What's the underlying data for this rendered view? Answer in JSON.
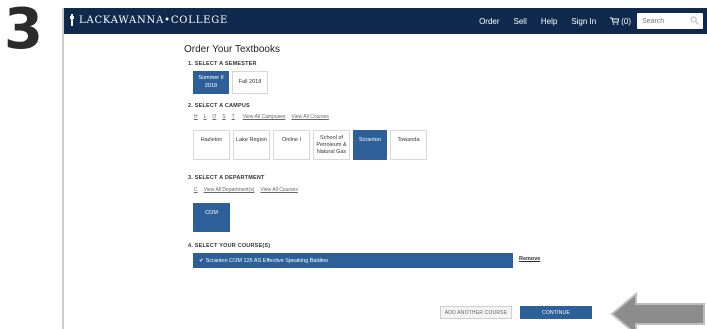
{
  "step": {
    "number": "3"
  },
  "header": {
    "logo_text": "LACKAWANNA•COLLEGE",
    "nav": [
      "Order",
      "Sell",
      "Help",
      "Sign In"
    ],
    "cart_label": "(0)",
    "search_placeholder": "Search"
  },
  "page": {
    "title": "Order Your Textbooks"
  },
  "semester": {
    "heading": "1. SELECT A SEMESTER",
    "options": [
      {
        "label": "Summer II 2018",
        "selected": true
      },
      {
        "label": "Fall 2018",
        "selected": false
      }
    ]
  },
  "campus": {
    "heading": "2. SELECT A CAMPUS",
    "filters": {
      "letters": [
        "H",
        "L",
        "O",
        "S",
        "T"
      ],
      "view_all_campuses": "View All Campuses",
      "view_all_courses": "View All Courses"
    },
    "options": [
      {
        "label": "Hazleton",
        "selected": false
      },
      {
        "label": "Lake Region",
        "selected": false
      },
      {
        "label": "Online I",
        "selected": false
      },
      {
        "label": "School of Petroleum & Natural Gas",
        "selected": false
      },
      {
        "label": "Scranton",
        "selected": true
      },
      {
        "label": "Towanda",
        "selected": false
      }
    ]
  },
  "department": {
    "heading": "3. SELECT A DEPARTMENT",
    "filters": {
      "letter": "C",
      "view_all_departments": "View All Department(s)",
      "view_all_courses": "View All Courses"
    },
    "options": [
      {
        "label": "COM",
        "selected": true
      }
    ]
  },
  "courses": {
    "heading": "4. SELECT YOUR COURSE(S)",
    "selected_course": "Scranton COM 125 AS Effective Speaking Baldino",
    "remove_label": "Remove"
  },
  "actions": {
    "add_another": "ADD ANOTHER COURSE",
    "continue": "CONTINUE"
  },
  "colors": {
    "header_bg": "#0f2a4d",
    "accent": "#2d5f99",
    "arrow": "#8c8c8c"
  }
}
